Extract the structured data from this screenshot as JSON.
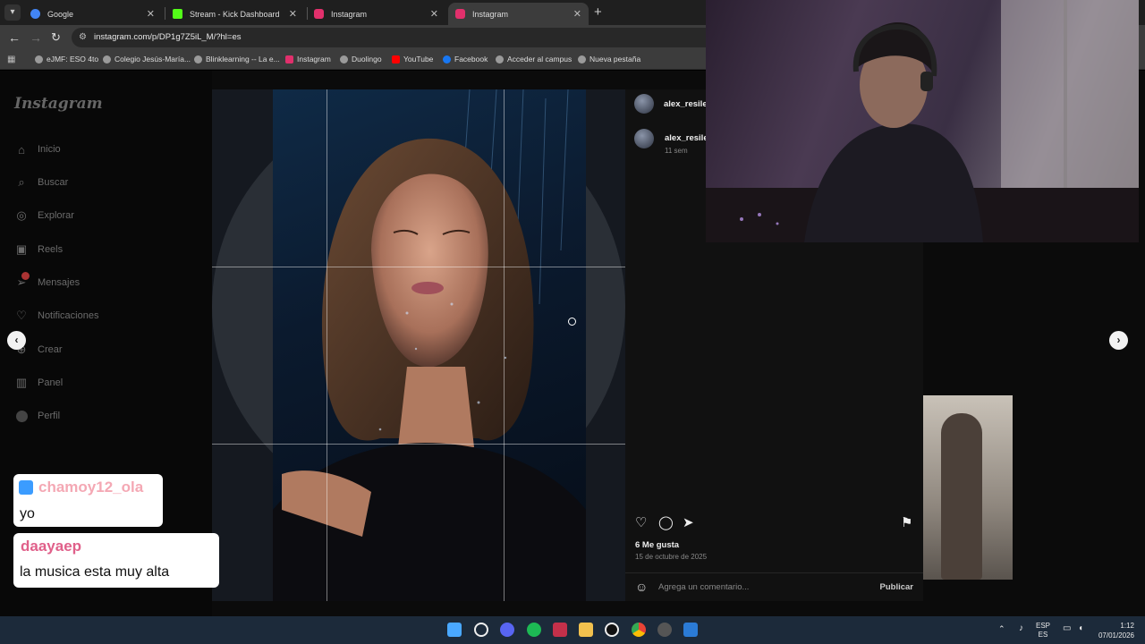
{
  "browser": {
    "tabs": [
      {
        "title": "Google",
        "active": false,
        "favicon_color": "#4285f4"
      },
      {
        "title": "Stream - Kick Dashboard",
        "active": false,
        "favicon_color": "#53fc18"
      },
      {
        "title": "Instagram",
        "active": false,
        "favicon_color": "#e1306c"
      },
      {
        "title": "Instagram",
        "active": true,
        "favicon_color": "#e1306c"
      }
    ],
    "url": "instagram.com/p/DP1g7Z5iL_M/?hl=es",
    "bookmarks": [
      "eJMF: ESO 4to",
      "Colegio Jesús-María...",
      "Blinklearning -- La e...",
      "Instagram",
      "Duolingo",
      "YouTube",
      "Facebook",
      "Acceder al campus",
      "Nueva pestaña"
    ]
  },
  "instagram": {
    "logo": "Instagram",
    "nav": [
      {
        "label": "Inicio",
        "icon": "home-icon"
      },
      {
        "label": "Buscar",
        "icon": "search-icon"
      },
      {
        "label": "Explorar",
        "icon": "compass-icon"
      },
      {
        "label": "Reels",
        "icon": "reels-icon"
      },
      {
        "label": "Mensajes",
        "icon": "messages-icon"
      },
      {
        "label": "Notificaciones",
        "icon": "heart-icon"
      },
      {
        "label": "Crear",
        "icon": "plus-icon"
      },
      {
        "label": "Panel",
        "icon": "chart-icon"
      },
      {
        "label": "Perfil",
        "icon": "profile-icon"
      }
    ],
    "post": {
      "username": "alex_resiler",
      "caption_username": "alex_resiler",
      "time_ago": "11 sem",
      "likes": "6 Me gusta",
      "date": "15 de octubre de 2025",
      "comment_placeholder": "Agrega un comentario...",
      "publish_label": "Publicar"
    }
  },
  "chat": [
    {
      "user": "chamoy12_ola",
      "message": "yo",
      "user_color": "#f4a8b4"
    },
    {
      "user": "daayaep",
      "message": "la musica esta muy alta",
      "user_color": "#e0608a"
    }
  ],
  "taskbar": {
    "language_top": "ESP",
    "language_bottom": "ES",
    "time": "1:12",
    "date": "07/01/2026"
  }
}
